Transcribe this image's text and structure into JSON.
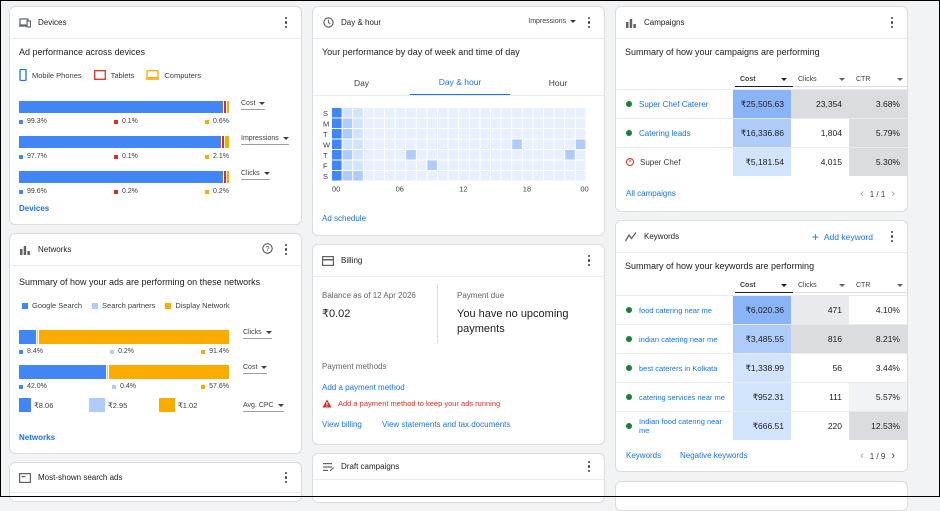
{
  "devices": {
    "title": "Devices",
    "subtitle": "Ad performance across devices",
    "legend": [
      {
        "label": "Mobile Phones",
        "color": "#1a73e8"
      },
      {
        "label": "Tablets",
        "color": "#d93025"
      },
      {
        "label": "Computers",
        "color": "#f9ab00"
      }
    ],
    "metrics": [
      {
        "label": "Cost",
        "mobile": "99.3%",
        "tablet": "0.1%",
        "computer": "0.6%",
        "fractions": [
          0.993,
          0.001,
          0.006
        ]
      },
      {
        "label": "Impressions",
        "mobile": "97.7%",
        "tablet": "0.1%",
        "computer": "2.1%",
        "fractions": [
          0.977,
          0.001,
          0.021
        ]
      },
      {
        "label": "Clicks",
        "mobile": "99.6%",
        "tablet": "0.2%",
        "computer": "0.2%",
        "fractions": [
          0.996,
          0.002,
          0.002
        ]
      }
    ],
    "link": "Devices"
  },
  "networks": {
    "title": "Networks",
    "subtitle": "Summary of how your ads are performing on these networks",
    "legend": [
      {
        "label": "Google Search",
        "color": "#4285f4"
      },
      {
        "label": "Search partners",
        "color": "#aecbfa"
      },
      {
        "label": "Display Network",
        "color": "#f9ab00"
      }
    ],
    "metrics": [
      {
        "label": "Clicks",
        "a": "8.4%",
        "b": "0.2%",
        "c": "91.4%",
        "fractions": [
          0.084,
          0.002,
          0.914
        ]
      },
      {
        "label": "Cost",
        "a": "42.0%",
        "b": "0.4%",
        "c": "57.6%",
        "fractions": [
          0.42,
          0.004,
          0.576
        ]
      }
    ],
    "cpc": {
      "label": "Avg. CPC",
      "a": "₹8.06",
      "b": "₹2.95",
      "c": "₹1.02"
    },
    "link": "Networks"
  },
  "most_shown": {
    "title": "Most-shown search ads"
  },
  "dayhour": {
    "title": "Day & hour",
    "metric": "Impressions",
    "subtitle": "Your performance by day of week and time of day",
    "tabs": [
      "Day",
      "Day & hour",
      "Hour"
    ],
    "active_tab": 1,
    "days": [
      "S",
      "M",
      "T",
      "W",
      "T",
      "F",
      "S"
    ],
    "hours": [
      "00",
      "06",
      "12",
      "18",
      "00"
    ],
    "link": "Ad schedule"
  },
  "billing": {
    "title": "Billing",
    "balance_label": "Balance as of 12 Apr 2026",
    "balance": "₹0.02",
    "due_label": "Payment due",
    "due_text": "You have no upcoming payments",
    "methods_label": "Payment methods",
    "add_method": "Add a payment method",
    "warning": "Add a payment method to keep your ads running",
    "view_billing": "View billing",
    "view_statements": "View statements and tax documents"
  },
  "draft": {
    "title": "Draft campaigns"
  },
  "campaigns": {
    "title": "Campaigns",
    "subtitle": "Summary of how your campaigns are performing",
    "columns": [
      "Cost",
      "Clicks",
      "CTR"
    ],
    "rows": [
      {
        "name": "Super Chef Caterer",
        "status": "enabled",
        "cost": "₹25,505.63",
        "clicks": "23,354",
        "ctr": "3.68%"
      },
      {
        "name": "Catering leads",
        "status": "enabled",
        "cost": "₹16,336.86",
        "clicks": "1,804",
        "ctr": "5.79%"
      },
      {
        "name": "Super Chef",
        "status": "removed",
        "cost": "₹5,181.54",
        "clicks": "4,015",
        "ctr": "5.30%"
      }
    ],
    "link": "All campaigns",
    "pager": "1 / 1"
  },
  "keywords": {
    "title": "Keywords",
    "add": "Add keyword",
    "subtitle": "Summary of how your keywords are performing",
    "columns": [
      "Cost",
      "Clicks",
      "CTR"
    ],
    "rows": [
      {
        "name": "food catering near me",
        "cost": "₹6,020.36",
        "clicks": "471",
        "ctr": "4.10%"
      },
      {
        "name": "indian catering near me",
        "cost": "₹3,485.55",
        "clicks": "816",
        "ctr": "8.21%"
      },
      {
        "name": "best caterers in Kolkata",
        "cost": "₹1,338.99",
        "clicks": "56",
        "ctr": "3.44%"
      },
      {
        "name": "catering services near me",
        "cost": "₹952.31",
        "clicks": "111",
        "ctr": "5.57%"
      },
      {
        "name": "Indian food catering near me",
        "cost": "₹666.51",
        "clicks": "220",
        "ctr": "12.53%"
      }
    ],
    "link1": "Keywords",
    "link2": "Negative keywords",
    "pager": "1 / 9"
  }
}
